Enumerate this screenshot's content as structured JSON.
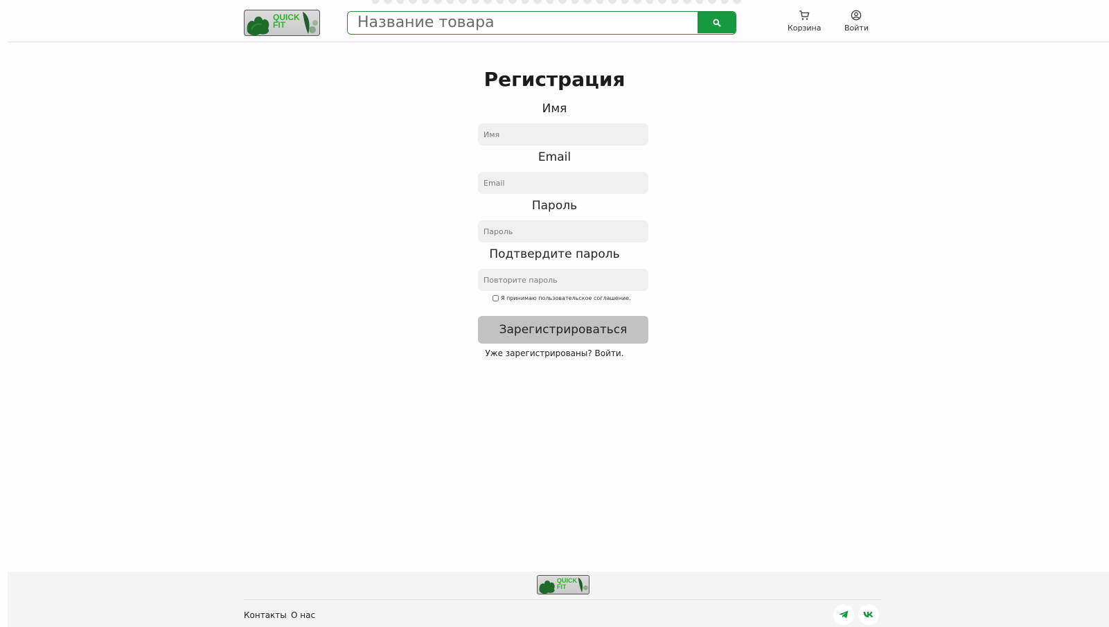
{
  "header": {
    "logo_text": "QUICK\nFIT",
    "search": {
      "placeholder": "Название товара",
      "value": ""
    },
    "nav": [
      {
        "label": "Корзина",
        "icon": "cart-icon"
      },
      {
        "label": "Войти",
        "icon": "user-circle-icon"
      }
    ]
  },
  "form": {
    "title": "Регистрация",
    "fields": [
      {
        "label": "Имя",
        "placeholder": "Имя"
      },
      {
        "label": "Email",
        "placeholder": "Email"
      },
      {
        "label": "Пароль",
        "placeholder": "Пароль"
      },
      {
        "label": "Подтвердите пароль",
        "placeholder": "Повторите пароль"
      }
    ],
    "agreement": "Я принимаю пользовательское соглашение.",
    "submit_label": "Зарегистрироваться",
    "login_link": "Уже зарегистрированы? Войти."
  },
  "footer": {
    "logo_text": "QUICK\nFIT",
    "links": [
      "Контакты",
      "О нас"
    ],
    "social": [
      "telegram-icon",
      "vk-icon"
    ]
  },
  "colors": {
    "accent": "#17993f",
    "border": "#2a8a45",
    "input_bg": "#f0f0f0",
    "button_disabled": "#c2c2c2",
    "footer_bg": "#f4f4f4"
  }
}
